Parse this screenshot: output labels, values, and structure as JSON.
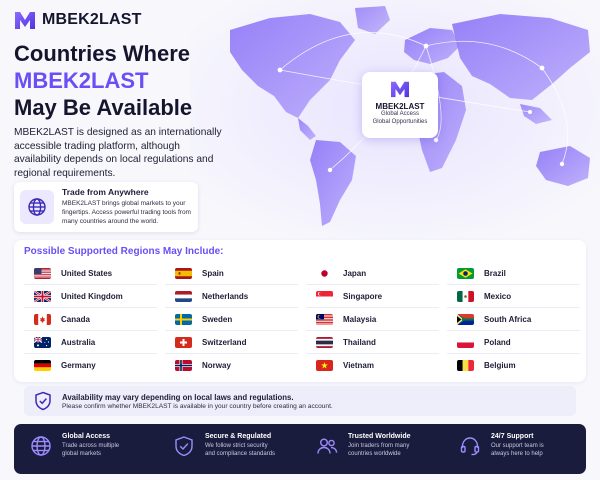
{
  "brand": {
    "name": "MBEK2LAST",
    "accent": "#6b4ef5",
    "dark": "#1a1c3d"
  },
  "hero": {
    "title_line1": "Countries Where",
    "title_line2": "MBEK2LAST",
    "title_line3": "May Be Available",
    "description": "MBEK2LAST is designed as an internationally accessible trading platform, although availability depends on local regulations and regional requirements."
  },
  "feature": {
    "icon": "globe-icon",
    "title": "Trade from Anywhere",
    "text": "MBEK2LAST brings global markets to your fingertips. Access powerful trading tools from many countries around the world."
  },
  "badge": {
    "name": "MBEK2LAST",
    "line1": "Global Access",
    "line2": "Global Opportunities"
  },
  "regions": {
    "title": "Possible Supported Regions May Include:",
    "columns": [
      [
        "United States",
        "United Kingdom",
        "Canada",
        "Australia",
        "Germany"
      ],
      [
        "Spain",
        "Netherlands",
        "Sweden",
        "Switzerland",
        "Norway"
      ],
      [
        "Japan",
        "Singapore",
        "Malaysia",
        "Thailand",
        "Vietnam"
      ],
      [
        "Brazil",
        "Mexico",
        "South Africa",
        "Poland",
        "Belgium"
      ]
    ]
  },
  "notice": {
    "icon": "shield-check-icon",
    "title": "Availability may vary depending on local laws and regulations.",
    "text": "Please confirm whether MBEK2LAST is available in your country before creating an account."
  },
  "footer": [
    {
      "icon": "globe-icon",
      "title": "Global Access",
      "line1": "Trade across multiple",
      "line2": "global markets"
    },
    {
      "icon": "shield-check-icon",
      "title": "Secure & Regulated",
      "line1": "We follow strict security",
      "line2": "and compliance standards"
    },
    {
      "icon": "users-icon",
      "title": "Trusted Worldwide",
      "line1": "Join traders from many",
      "line2": "countries worldwide"
    },
    {
      "icon": "headset-icon",
      "title": "24/7 Support",
      "line1": "Our support team is",
      "line2": "always here to help"
    }
  ]
}
